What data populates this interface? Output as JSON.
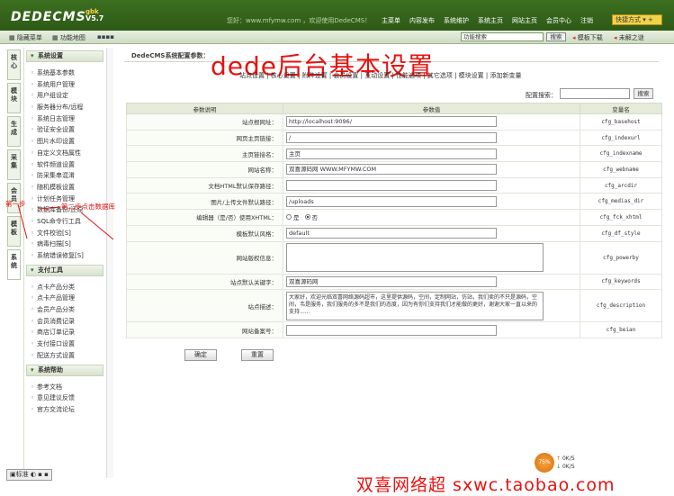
{
  "app": {
    "logo": "DEDECMS",
    "version": "V5.7",
    "version_tag": "gbk"
  },
  "header": {
    "welcome": "您好：www.mfymw.com ，欢迎使用DedeCMS！",
    "nav": [
      "主菜单",
      "内容发布",
      "系统维护",
      "系统主页",
      "网站主页",
      "会员中心",
      "注销"
    ],
    "quick_label": "快捷方式 ▾ +"
  },
  "subbar": {
    "hide_menu": "隐藏菜单",
    "func_map": "功能地图",
    "search_placeholder": "功能搜索",
    "search_btn": "搜索",
    "template_download": "模板下载",
    "unsolved": "未解之谜"
  },
  "sidetabs": [
    "核心",
    "模块",
    "生成",
    "采集",
    "会员",
    "模板",
    "系统"
  ],
  "menu": {
    "section1": "系统设置",
    "items1": [
      "系统基本参数",
      "系统用户管理",
      "用户组设定",
      "服务器分布/远程",
      "系统日志管理",
      "验证安全设置",
      "图片水印设置",
      "自定义文档属性",
      "软件频道设置",
      "防采集串混淆",
      "随机模板设置",
      "计划任务管理",
      "数据库备份/还原",
      "SQL命令行工具",
      "文件校验[S]",
      "病毒扫描[S]",
      "系统错误修复[S]"
    ],
    "section2": "支付工具",
    "items2": [
      "点卡产品分类",
      "点卡产品管理",
      "会员产品分类",
      "会员消费记录",
      "商店订单记录",
      "支付接口设置",
      "配送方式设置"
    ],
    "section3": "系统帮助",
    "items3": [
      "参考文档",
      "意见建议反馈",
      "官方交流论坛"
    ]
  },
  "main": {
    "title": "DedeCMS系统配置参数：",
    "overlay": "dede后台基本设置",
    "tabs": "站点设置 | 核心设置 | 附件设置 | 会员设置 | 互动设置 | 性能选项 | 其它选项 | 模块设置 | 添加新变量",
    "cfg_search_label": "配置搜索：",
    "cfg_search_btn": "搜索",
    "columns": [
      "参数说明",
      "参数值",
      "变量名"
    ],
    "rows": [
      {
        "label": "站点根网址：",
        "value": "http://localhost:9096/",
        "key": "cfg_basehost"
      },
      {
        "label": "网页主页链接：",
        "value": "/",
        "key": "cfg_indexurl"
      },
      {
        "label": "主页链接名：",
        "value": "主页",
        "key": "cfg_indexname"
      },
      {
        "label": "网站名称：",
        "value": "双喜源码网   WWW.MFYMW.COM",
        "key": "cfg_webname"
      },
      {
        "label": "文档HTML默认保存路径：",
        "value": "",
        "key": "cfg_arcdir"
      },
      {
        "label": "图片/上传文件默认路径：",
        "value": "/uploads",
        "key": "cfg_medias_dir"
      },
      {
        "label": "编辑器（是/否）使用XHTML：",
        "value": "",
        "key": "cfg_fck_xhtml"
      },
      {
        "label": "模板默认风格：",
        "value": "default",
        "key": "cfg_df_style"
      },
      {
        "label": "网站版权信息：",
        "value": "",
        "key": "cfg_powerby"
      },
      {
        "label": "站点默认关键字：",
        "value": "双喜源码网",
        "key": "cfg_keywords"
      },
      {
        "label": "站点描述：",
        "value": "大家好，欢迎光临双喜网络源码超市，这里提供源码，空间，定制网站，仿站，我们卖的不只是源码，空间，韦是服务，我们服务的多不是我们的态度，因为有你们支持我们才能做的更好，谢谢大家一直以来的支持......",
        "key": "cfg_description"
      },
      {
        "label": "网站备案号：",
        "value": "",
        "key": "cfg_beian"
      }
    ],
    "radio_yes": "是",
    "radio_no": "否",
    "ok_btn": "确定",
    "reset_btn": "重置"
  },
  "annotations": {
    "step1": "第一步",
    "step2": "第二步点击数据库"
  },
  "footer": {
    "status": "标准",
    "ad": "双喜网络超 sxwc.taobao.com",
    "net_percent": "75%",
    "up_rate": "0K/S",
    "down_rate": "0K/S"
  }
}
